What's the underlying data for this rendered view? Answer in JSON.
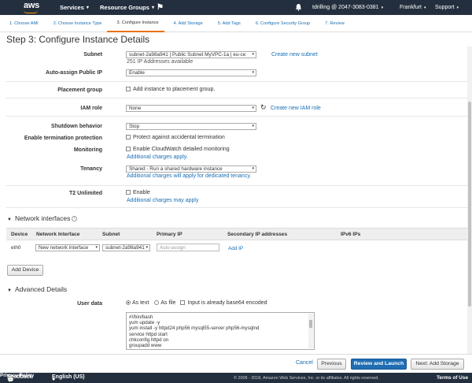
{
  "nav": {
    "brand": "aws",
    "services": "Services",
    "resource_groups": "Resource Groups",
    "account": "tdrilling @ 2047-3083-0381",
    "region": "Frankfurt",
    "support": "Support"
  },
  "wizard": {
    "steps": [
      {
        "label": "1. Choose AMI"
      },
      {
        "label": "2. Choose Instance Type"
      },
      {
        "label": "3. Configure Instance"
      },
      {
        "label": "4. Add Storage"
      },
      {
        "label": "5. Add Tags"
      },
      {
        "label": "6. Configure Security Group"
      },
      {
        "label": "7. Review"
      }
    ]
  },
  "page": {
    "title": "Step 3: Configure Instance Details"
  },
  "form": {
    "subnet": {
      "label": "Subnet",
      "value": "subnet-2a98a941 | Public Subnet MyVPC-1a | eu-ce",
      "note": "251 IP Addresses available",
      "link": "Create new subnet"
    },
    "auto_ip": {
      "label": "Auto-assign Public IP",
      "value": "Enable"
    },
    "placement": {
      "label": "Placement group",
      "option": "Add instance to placement group."
    },
    "iam": {
      "label": "IAM role",
      "value": "None",
      "link": "Create new IAM role"
    },
    "shutdown": {
      "label": "Shutdown behavior",
      "value": "Stop"
    },
    "termination": {
      "label": "Enable termination protection",
      "option": "Protect against accidental termination"
    },
    "monitoring": {
      "label": "Monitoring",
      "option": "Enable CloudWatch detailed monitoring",
      "link": "Additional charges apply."
    },
    "tenancy": {
      "label": "Tenancy",
      "value": "Shared - Run a shared hardware instance",
      "link": "Additional charges will apply for dedicated tenancy."
    },
    "t2": {
      "label": "T2 Unlimited",
      "option": "Enable",
      "link": "Additional charges may apply"
    }
  },
  "network": {
    "heading": "Network interfaces",
    "columns": [
      "Device",
      "Network Interface",
      "Subnet",
      "Primary IP",
      "Secondary IP addresses",
      "IPv6 IPs"
    ],
    "row": {
      "device": "eth0",
      "interface": "New network interface",
      "subnet": "subnet-2a98a941",
      "primary_ip_placeholder": "Auto-assign",
      "add_ip": "Add IP"
    },
    "add_device": "Add Device"
  },
  "advanced": {
    "heading": "Advanced Details",
    "user_data_label": "User data",
    "opt_text": "As text",
    "opt_file": "As file",
    "opt_base64": "Input is already base64 encoded",
    "script_lines": [
      "#!/bin/bash",
      "yum update -y",
      "yum install -y httpd24 php56 mysql55-server php56-mysqlnd",
      "service httpd start",
      "chkconfig httpd on",
      "groupadd www"
    ]
  },
  "actions": {
    "cancel": "Cancel",
    "previous": "Previous",
    "review": "Review and Launch",
    "next": "Next: Add Storage"
  },
  "footer": {
    "feedback": "Feedback",
    "language": "English (US)",
    "copyright": "© 2008 - 2018, Amazon Web Services, Inc. or its affiliates. All rights reserved.",
    "privacy": "Privacy Policy",
    "terms": "Terms of Use"
  },
  "colors": {
    "nav_bg": "#232f3e",
    "accent": "#ec7211",
    "link": "#1a6fb4",
    "primary_button": "#1f6db3"
  }
}
